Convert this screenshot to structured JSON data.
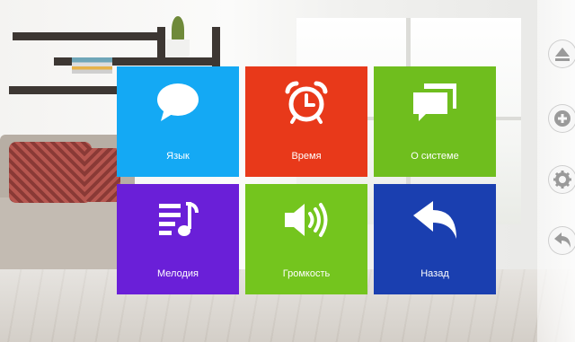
{
  "menu": {
    "tiles": [
      {
        "label": "Язык",
        "icon": "speech-bubble-icon",
        "color": "#14a9f4"
      },
      {
        "label": "Время",
        "icon": "alarm-clock-icon",
        "color": "#e8391a"
      },
      {
        "label": "О системе",
        "icon": "stacked-messages-icon",
        "color": "#6fbe1e"
      },
      {
        "label": "Мелодия",
        "icon": "music-list-icon",
        "color": "#6a1fd8"
      },
      {
        "label": "Громкость",
        "icon": "speaker-volume-icon",
        "color": "#74c51e"
      },
      {
        "label": "Назад",
        "icon": "back-arrow-icon",
        "color": "#1a3fb0"
      }
    ]
  },
  "side_buttons": [
    {
      "icon": "eject-up-icon"
    },
    {
      "icon": "plus-icon"
    },
    {
      "icon": "gear-icon"
    },
    {
      "icon": "back-arrow-icon"
    }
  ]
}
